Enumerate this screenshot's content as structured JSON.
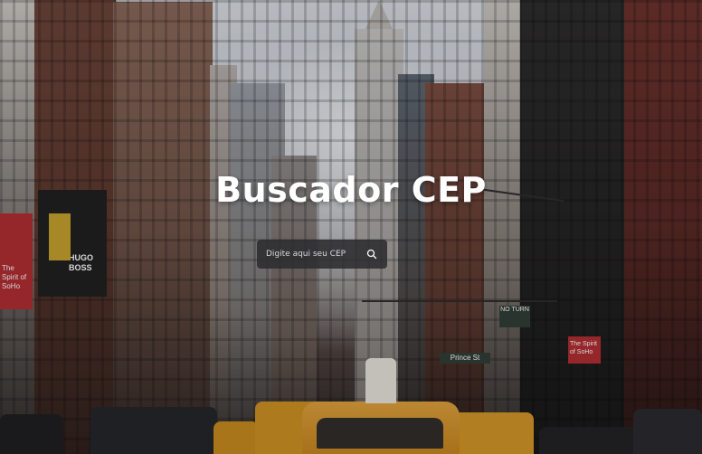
{
  "hero": {
    "title": "Buscador CEP"
  },
  "search": {
    "placeholder": "Digite aqui seu CEP",
    "value": "",
    "button_icon": "search-icon"
  },
  "background_signs": {
    "banner_left": "The Spirit of SoHo",
    "banner_boss": "HUGO BOSS",
    "banner_right": "The Spirit of SoHo",
    "street_sign": "Prince St",
    "street_sign_2": "NO TURN"
  },
  "colors": {
    "title_text": "#ffffff",
    "search_bg": "#2c2c30",
    "placeholder_text": "#d8d8d8"
  }
}
